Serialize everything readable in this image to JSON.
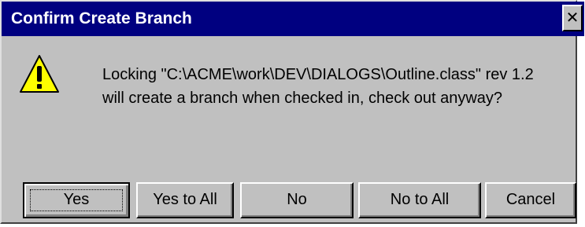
{
  "window": {
    "title": "Confirm Create Branch",
    "close_glyph": "✕",
    "colors": {
      "titlebar": "#000080",
      "face": "#c0c0c0"
    }
  },
  "dialog": {
    "icon": "warning-icon",
    "message_line1": "Locking \"C:\\ACME\\work\\DEV\\DIALOGS\\Outline.class\" rev 1.2",
    "message_line2": "will create a branch when checked in, check out anyway?"
  },
  "buttons": {
    "yes": "Yes",
    "yes_to_all": "Yes to All",
    "no": "No",
    "no_to_all": "No to All",
    "cancel": "Cancel"
  }
}
